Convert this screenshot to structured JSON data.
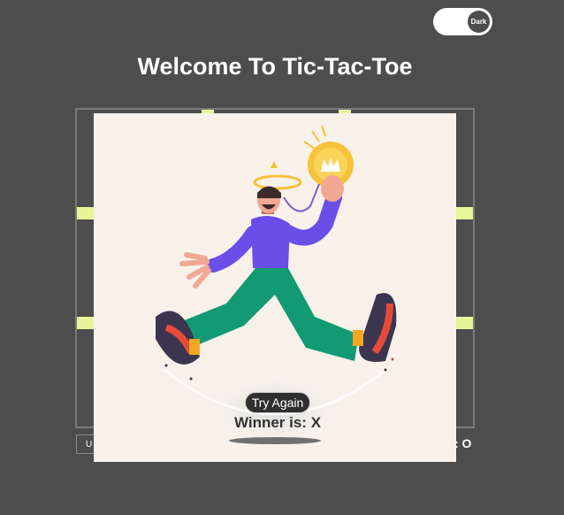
{
  "toggle": {
    "label": "Dark"
  },
  "header": {
    "title": "Welcome To Tic-Tac-Toe"
  },
  "board": {
    "grid_accent_color": "#e9f59a"
  },
  "controls": {
    "undo_label_partial": "U",
    "turn_text_partial": ": O"
  },
  "modal": {
    "try_again_label": "Try Again",
    "winner_text": "Winner is: X"
  },
  "colors": {
    "background": "#4d4d4d",
    "modal_bg": "#f7f1ea",
    "shirt": "#6a4ee8",
    "pants": "#129a72",
    "coin": "#f5c23a"
  }
}
